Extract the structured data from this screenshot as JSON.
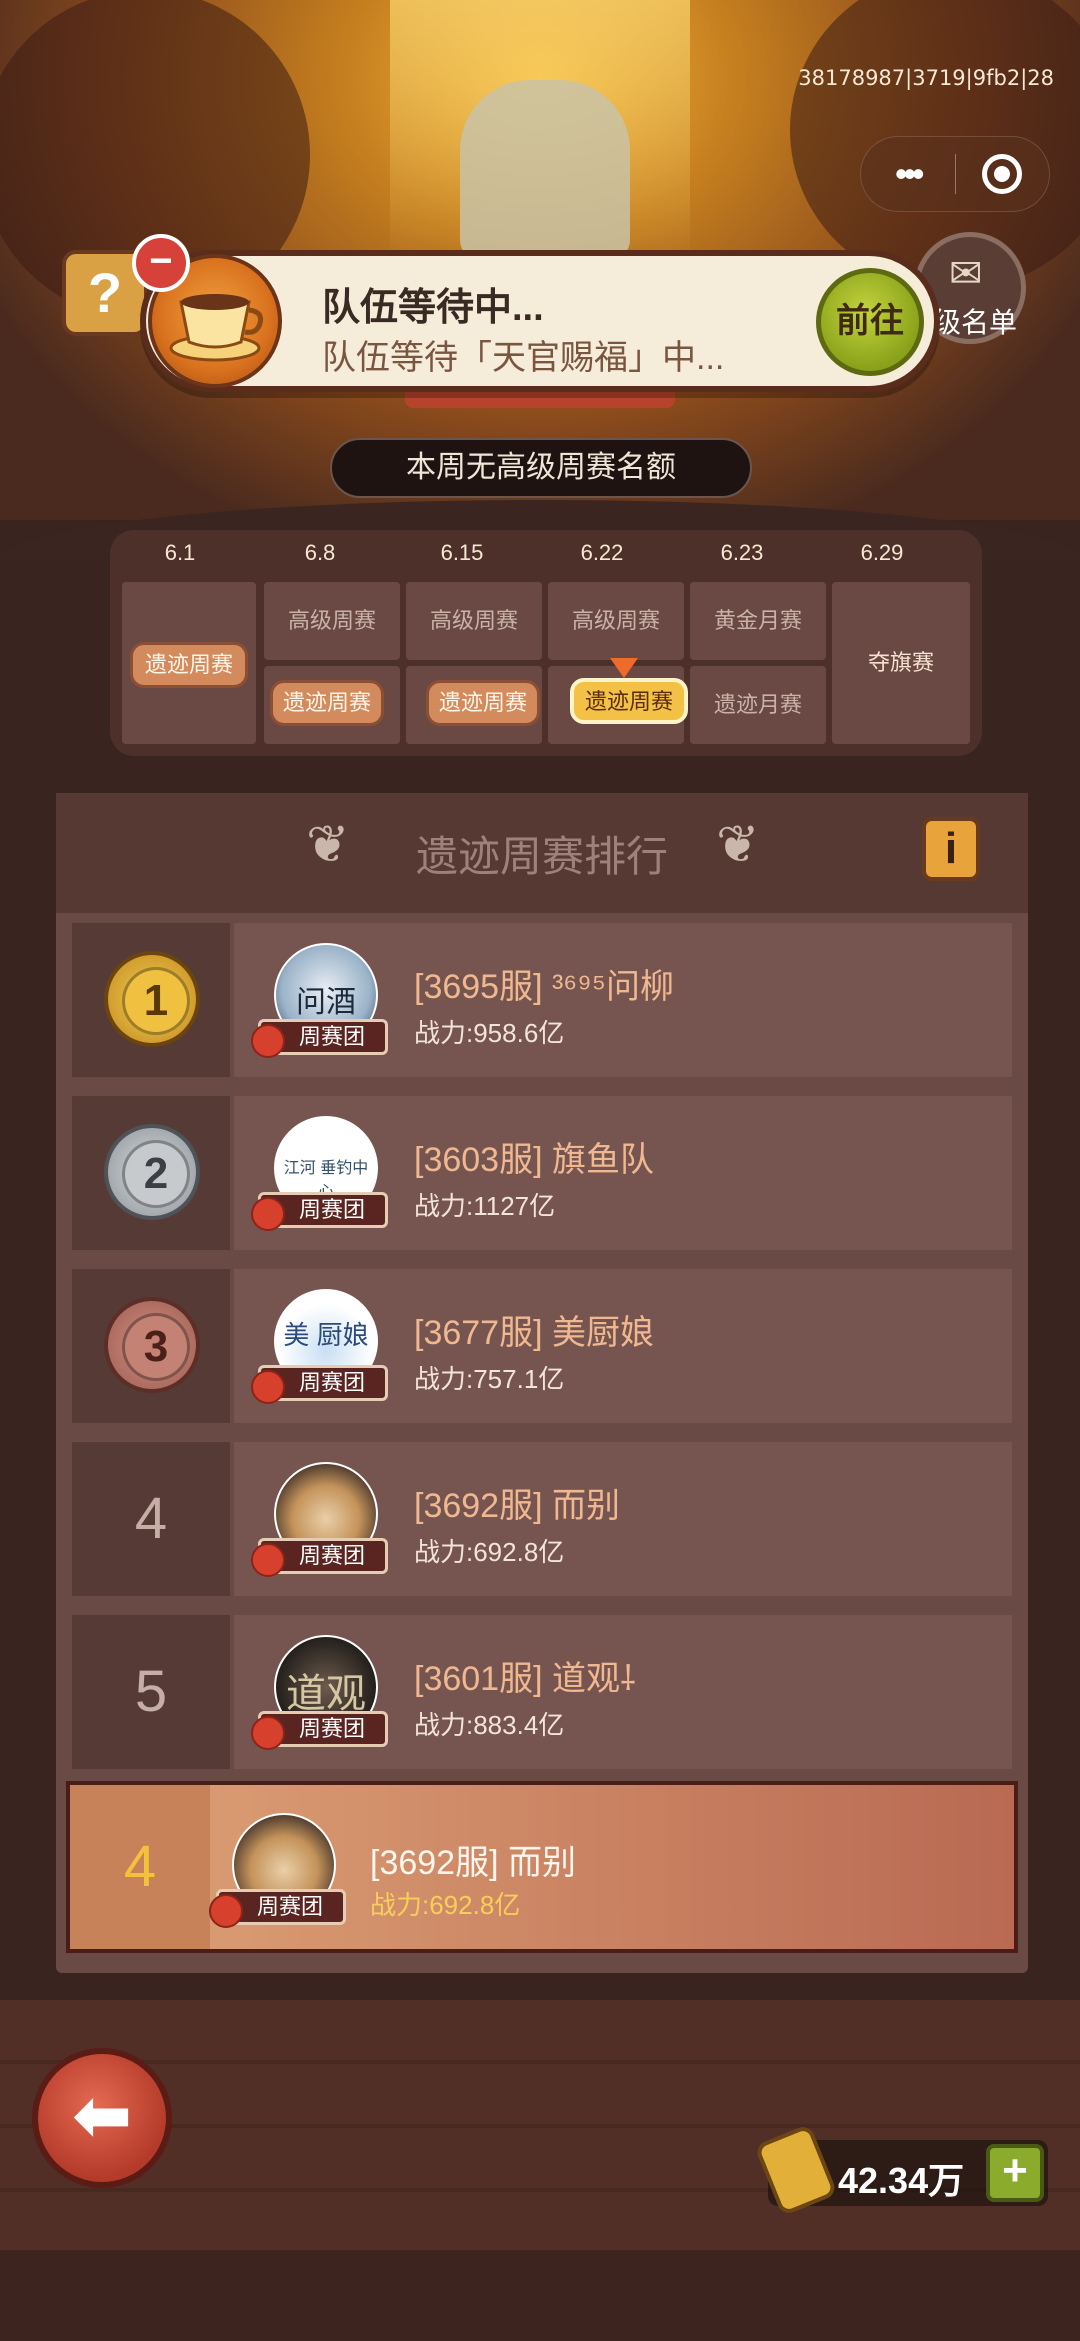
{
  "debug_id": "38178987|3719|9fb2|28",
  "capsule": {
    "more_label": "•••"
  },
  "queue": {
    "title": "队伍等待中...",
    "subtitle": "队伍等待「天官赐福」中...",
    "go_label": "前往"
  },
  "help_label": "?",
  "rank_list_label": "级名单",
  "no_quota_text": "本周无高级周赛名额",
  "schedule": {
    "dates": [
      "6.1",
      "6.8",
      "6.15",
      "6.22",
      "6.23",
      "6.29"
    ],
    "first_pill": "遗迹周赛",
    "top_row": [
      "高级周赛",
      "高级周赛",
      "高级周赛",
      "黄金月赛"
    ],
    "bottom_row": [
      "遗迹周赛",
      "遗迹周赛",
      "遗迹周赛",
      "遗迹月赛"
    ],
    "last_label": "夺旗赛",
    "selected_index": 2
  },
  "ranking": {
    "title": "遗迹周赛排行",
    "info_label": "i",
    "team_tag": "周赛团",
    "rows": [
      {
        "rank": "1",
        "name": "[3695服] ³⁶⁹⁵问柳",
        "power": "战力:958.6亿",
        "avatar": "问酒"
      },
      {
        "rank": "2",
        "name": "[3603服] 旗鱼队",
        "power": "战力:1127亿",
        "avatar": "江河 垂钓中心"
      },
      {
        "rank": "3",
        "name": "[3677服] 美厨娘",
        "power": "战力:757.1亿",
        "avatar": "美 厨娘"
      },
      {
        "rank": "4",
        "name": "[3692服] 而别",
        "power": "战力:692.8亿",
        "avatar": ""
      },
      {
        "rank": "5",
        "name": "[3601服] 道观⸸",
        "power": "战力:883.4亿",
        "avatar": "道观"
      }
    ],
    "me": {
      "rank": "4",
      "name": "[3692服] 而别",
      "power": "战力:692.8亿"
    }
  },
  "footer": {
    "back_label": "⬅",
    "currency": "42.34万",
    "plus_label": "+"
  }
}
